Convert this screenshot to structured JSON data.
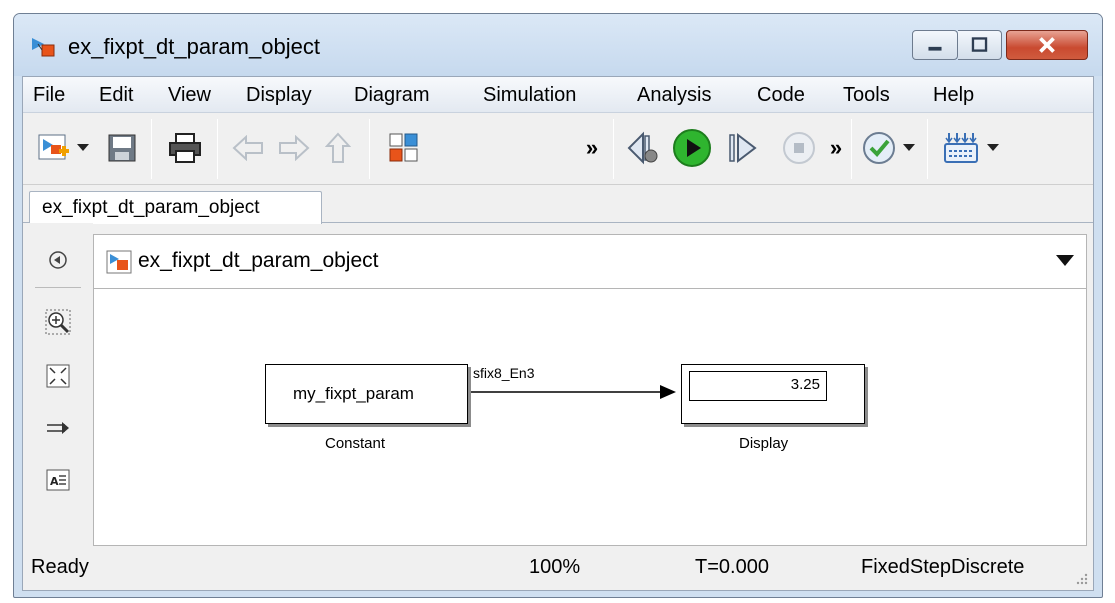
{
  "window": {
    "title": "ex_fixpt_dt_param_object"
  },
  "menu": [
    "File",
    "Edit",
    "View",
    "Display",
    "Diagram",
    "Simulation",
    "Analysis",
    "Code",
    "Tools",
    "Help"
  ],
  "toolbar": {
    "icons": [
      "new-model-icon",
      "save-icon",
      "print-icon",
      "back-icon",
      "forward-icon",
      "up-icon",
      "library-browser-icon",
      "run-icon",
      "stop-icon"
    ],
    "overflow_label": "»"
  },
  "tab": {
    "label": "ex_fixpt_dt_param_object"
  },
  "address": {
    "path": "ex_fixpt_dt_param_object"
  },
  "diagram": {
    "constant_block": {
      "value": "my_fixpt_param",
      "name": "Constant"
    },
    "signal_label": "sfix8_En3",
    "display_block": {
      "value": "3.25",
      "name": "Display"
    }
  },
  "status": {
    "state": "Ready",
    "zoom": "100%",
    "time": "T=0.000",
    "solver": "FixedStepDiscrete"
  },
  "colors": {
    "title_bg": "#c6d9ee",
    "close_button": "#c94a30",
    "run_green": "#2fb52f"
  }
}
